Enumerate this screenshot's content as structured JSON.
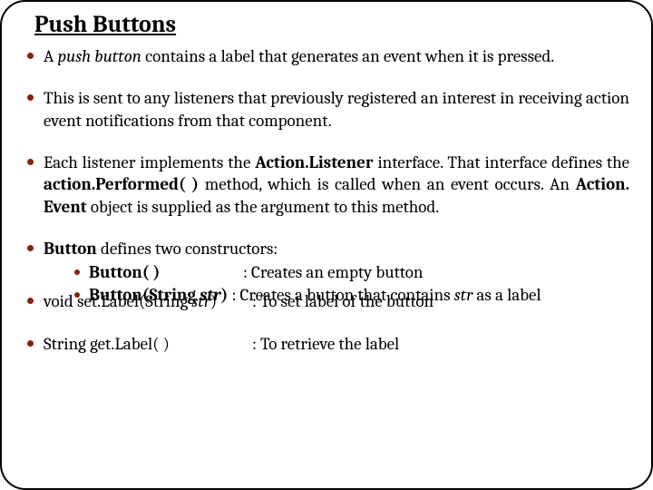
{
  "title": "Push Buttons",
  "bullets": {
    "b1_pre": "A ",
    "b1_em": "push button",
    "b1_post": " contains a label that generates an event when it is pressed.",
    "b2": "This is sent to any listeners that previously registered an interest in receiving action event notifications from that component.",
    "b3_a": "Each listener implements the ",
    "b3_al": "Action.Listener",
    "b3_b": " interface. That interface defines the ",
    "b3_ap": "action.Performed( )",
    "b3_c": " method, which is called when an event occurs. An ",
    "b3_ae": "Action. Event",
    "b3_d": " object is supplied as the argument to this method.",
    "b4_lead": "Button",
    "b4_post": " defines two constructors:",
    "b4s1_sig": "Button( )",
    "b4s1_desc": ": Creates an empty button",
    "b4s2_sig": "Button(String ",
    "b4s2_str": "str",
    "b4s2_close": ")",
    "b4s2_desc_a": " : Creates a button that contains ",
    "b4s2_desc_str": "str",
    "b4s2_desc_b": " as a label",
    "b5_sig_a": "void set.Label(String ",
    "b5_sig_str": "str",
    "b5_sig_b": ")",
    "b5_desc": ": To set label of the button",
    "b6_sig": "String get.Label( )",
    "b6_desc": ": To retrieve the label"
  }
}
